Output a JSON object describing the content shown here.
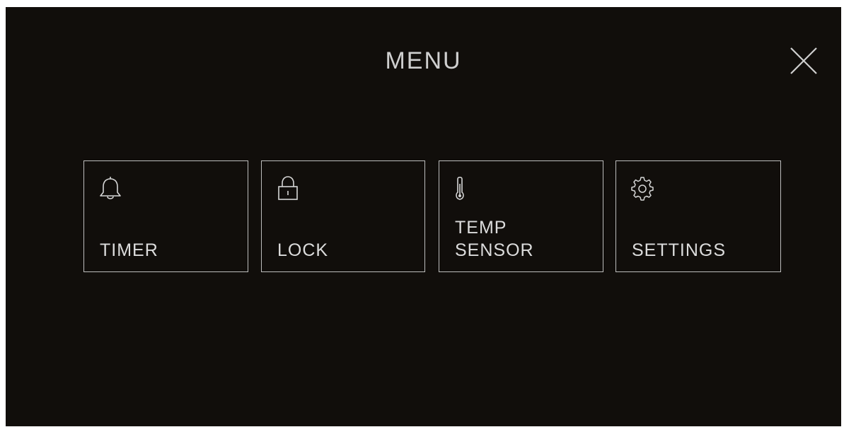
{
  "header": {
    "title": "MENU",
    "close_icon": "close-icon"
  },
  "tiles": [
    {
      "label": "TIMER",
      "icon": "bell-icon"
    },
    {
      "label": "LOCK",
      "icon": "lock-icon"
    },
    {
      "label": "TEMP\nSENSOR",
      "icon": "thermometer-icon"
    },
    {
      "label": "SETTINGS",
      "icon": "gear-icon"
    }
  ],
  "colors": {
    "background": "#110e0b",
    "foreground": "#d9d9d9",
    "border": "#bdbdbd"
  }
}
